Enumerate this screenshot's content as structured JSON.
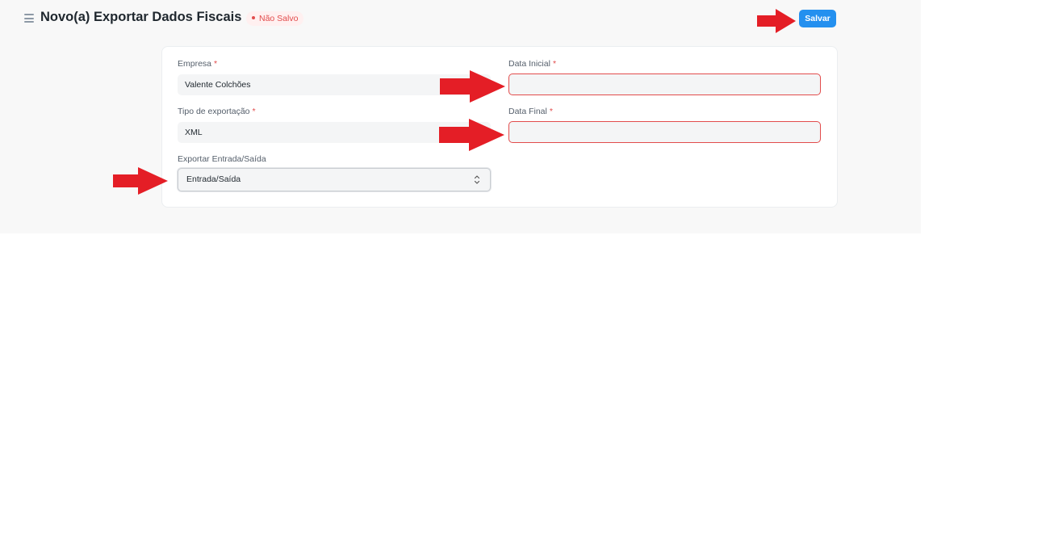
{
  "header": {
    "title": "Novo(a) Exportar Dados Fiscais",
    "status": "Não Salvo",
    "save_label": "Salvar"
  },
  "form": {
    "empresa": {
      "label": "Empresa",
      "required_mark": "*",
      "value": "Valente Colchões"
    },
    "tipo_exportacao": {
      "label": "Tipo de exportação",
      "required_mark": "*",
      "value": "XML"
    },
    "exportar_entrada_saida": {
      "label": "Exportar Entrada/Saída",
      "value": "Entrada/Saída"
    },
    "data_inicial": {
      "label": "Data Inicial",
      "required_mark": "*",
      "value": ""
    },
    "data_final": {
      "label": "Data Final",
      "required_mark": "*",
      "value": ""
    }
  },
  "colors": {
    "primary": "#2490ef",
    "error": "#e24c4c",
    "annotation_arrow": "#e41e26",
    "background": "#f8f8f8"
  },
  "icons": {
    "menu": "hamburger-menu-icon",
    "select": "chevron-updown-icon",
    "annotation": "red-arrow-annotation"
  }
}
